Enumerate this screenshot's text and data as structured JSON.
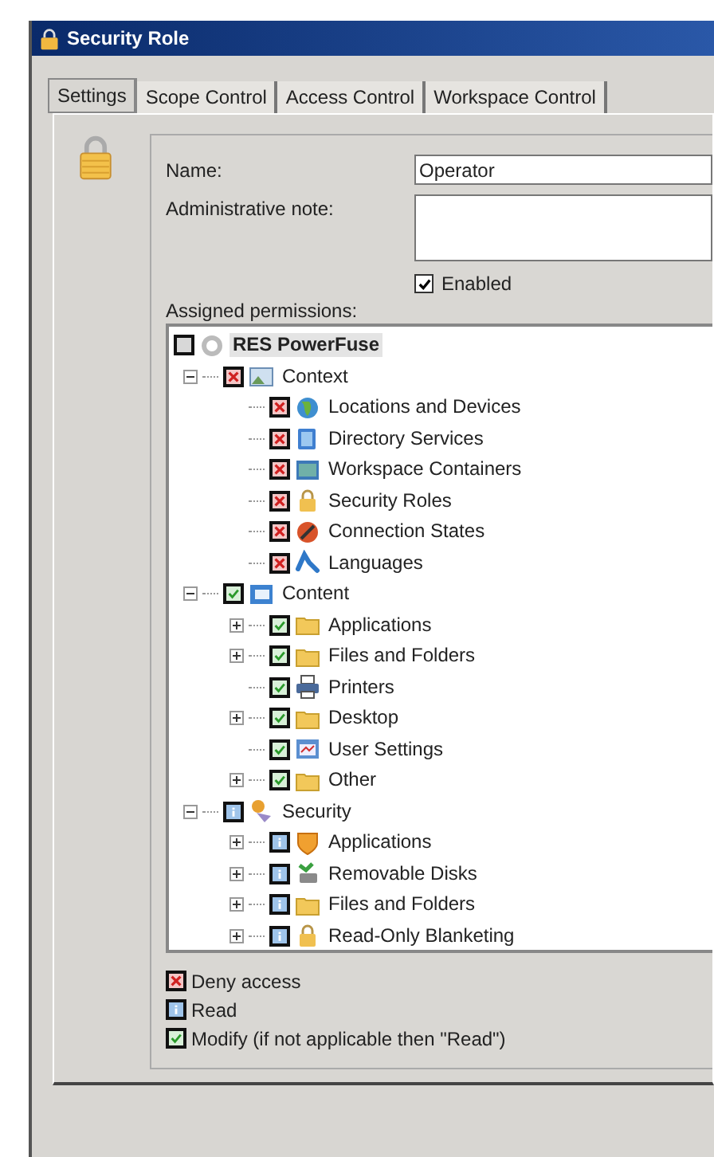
{
  "window": {
    "title": "Security Role"
  },
  "tabs": [
    {
      "label": "Settings",
      "selected": true
    },
    {
      "label": "Scope Control",
      "selected": false
    },
    {
      "label": "Access Control",
      "selected": false
    },
    {
      "label": "Workspace Control",
      "selected": false
    }
  ],
  "form": {
    "name_label": "Name:",
    "name_value": "Operator",
    "note_label": "Administrative note:",
    "enabled": {
      "label": "Enabled",
      "checked": true
    },
    "permissions_label": "Assigned permissions:"
  },
  "tree": [
    {
      "label": "RES PowerFuse",
      "kind": "none",
      "selected": true,
      "children": [
        {
          "label": "Context",
          "kind": "deny",
          "selected": false,
          "expanded": true,
          "children": [
            {
              "label": "Locations and Devices",
              "kind": "deny",
              "selected": false
            },
            {
              "label": "Directory Services",
              "kind": "deny",
              "selected": false
            },
            {
              "label": "Workspace Containers",
              "kind": "deny",
              "selected": false
            },
            {
              "label": "Security Roles",
              "kind": "deny",
              "selected": false
            },
            {
              "label": "Connection States",
              "kind": "deny",
              "selected": false
            },
            {
              "label": "Languages",
              "kind": "deny",
              "selected": false
            }
          ]
        },
        {
          "label": "Content",
          "kind": "modify",
          "selected": false,
          "expanded": true,
          "children": [
            {
              "label": "Applications",
              "kind": "modify",
              "selected": false,
              "expanded": false
            },
            {
              "label": "Files and Folders",
              "kind": "modify",
              "selected": false,
              "expanded": false
            },
            {
              "label": "Printers",
              "kind": "modify",
              "selected": false
            },
            {
              "label": "Desktop",
              "kind": "modify",
              "selected": false,
              "expanded": false
            },
            {
              "label": "User Settings",
              "kind": "modify",
              "selected": false
            },
            {
              "label": "Other",
              "kind": "modify",
              "selected": false,
              "expanded": false
            }
          ]
        },
        {
          "label": "Security",
          "kind": "read",
          "selected": false,
          "expanded": true,
          "children": [
            {
              "label": "Applications",
              "kind": "read",
              "selected": false,
              "expanded": false
            },
            {
              "label": "Removable Disks",
              "kind": "read",
              "selected": false,
              "expanded": false
            },
            {
              "label": "Files and Folders",
              "kind": "read",
              "selected": false,
              "expanded": false
            },
            {
              "label": "Read-Only Blanketing",
              "kind": "read",
              "selected": false,
              "expanded": false
            }
          ]
        }
      ]
    }
  ],
  "legend": [
    {
      "kind": "deny",
      "label": "Deny access"
    },
    {
      "kind": "read",
      "label": "Read"
    },
    {
      "kind": "modify",
      "label": "Modify (if not applicable then \"Read\")"
    }
  ]
}
